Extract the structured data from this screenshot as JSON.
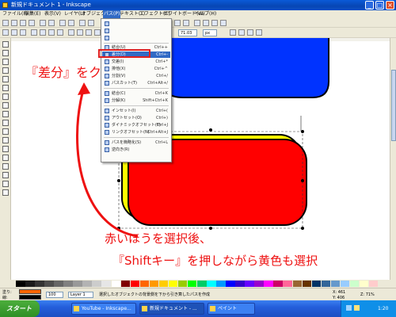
{
  "window": {
    "title": "新規ドキュメント 1 - Inkscape",
    "buttons": [
      "_",
      "□",
      "×"
    ]
  },
  "menubar": {
    "items": [
      "ファイル(F)",
      "編集(E)",
      "表示(V)",
      "レイヤ(L)",
      "オブジェクト(O)",
      "パス(P)",
      "テキスト(T)",
      "エフェクト(C)",
      "ホワイトボード(W)",
      "ヘルプ(H)"
    ],
    "active_index": 5
  },
  "toolbar": {
    "snap_label": "オブジェクトのスナップ",
    "trace_label": "ビットマップのトレース",
    "zoom_value": "71.03",
    "units": "px"
  },
  "path_menu": {
    "items": [
      {
        "label": "結合(U)",
        "shortcut": "Ctrl++"
      },
      {
        "label": "差分(D)",
        "shortcut": "Ctrl+-"
      },
      {
        "label": "交差(I)",
        "shortcut": "Ctrl+*"
      },
      {
        "label": "排他(X)",
        "shortcut": "Ctrl+^"
      },
      {
        "label": "分割(V)",
        "shortcut": "Ctrl+/"
      },
      {
        "label": "パスカット(T)",
        "shortcut": "Ctrl+Alt+/"
      },
      {
        "label": "結合(C)",
        "shortcut": "Ctrl+K"
      },
      {
        "label": "分解(K)",
        "shortcut": "Shift+Ctrl+K"
      },
      {
        "label": "インセット(I)",
        "shortcut": "Ctrl+("
      },
      {
        "label": "アウトセット(O)",
        "shortcut": "Ctrl+)"
      },
      {
        "label": "ダイナミックオフセット(Y)",
        "shortcut": "Ctrl+J"
      },
      {
        "label": "リンクオフセット(N)",
        "shortcut": "Ctrl+Alt+J"
      },
      {
        "label": "パスを簡略化(S)",
        "shortcut": "Ctrl+L"
      },
      {
        "label": "逆向き(R)",
        "shortcut": ""
      }
    ],
    "highlighted_index": 1
  },
  "annotations": {
    "click_instruction": "『差分』をクリック",
    "select_line1": "赤いほうを選択後、",
    "select_line2": "『Shiftキー』を押しながら黄色も選択"
  },
  "canvas_shapes": {
    "blue_shape_color": "#0033ff",
    "red_shape_color": "#ff0000",
    "yellow_shape_color": "#ffff00"
  },
  "statusbar": {
    "fill_label": "塗り:",
    "stroke_label": "線:",
    "opacity_value": "100",
    "layer_label": "Layer 1",
    "message": "選択したオブジェクトの背景側を下から引き算したパスを作成",
    "coord_x": "X: 461",
    "coord_y": "Y: 406",
    "zoom_label": "Z: 71%"
  },
  "taskbar": {
    "start_label": "スタート",
    "tasks": [
      "YouTube - Inkscape...",
      "新規ドキュメント - ...",
      "ペイント"
    ],
    "active_task_index": 1,
    "clock": "1:20"
  },
  "palette_colors": [
    "#000000",
    "#1a1a1a",
    "#333333",
    "#4d4d4d",
    "#666666",
    "#808080",
    "#999999",
    "#b3b3b3",
    "#cccccc",
    "#e6e6e6",
    "#ffffff",
    "#800000",
    "#ff0000",
    "#ff6600",
    "#ff9900",
    "#ffcc00",
    "#ffff00",
    "#99cc00",
    "#00ff00",
    "#00cc66",
    "#00ffff",
    "#0099ff",
    "#0000ff",
    "#3300cc",
    "#6600ff",
    "#9900cc",
    "#ff00ff",
    "#cc0066",
    "#ff6699",
    "#996633",
    "#663300",
    "#003366",
    "#336699",
    "#6699cc",
    "#99ccff",
    "#ccffcc",
    "#ffffcc",
    "#ffcccc"
  ]
}
